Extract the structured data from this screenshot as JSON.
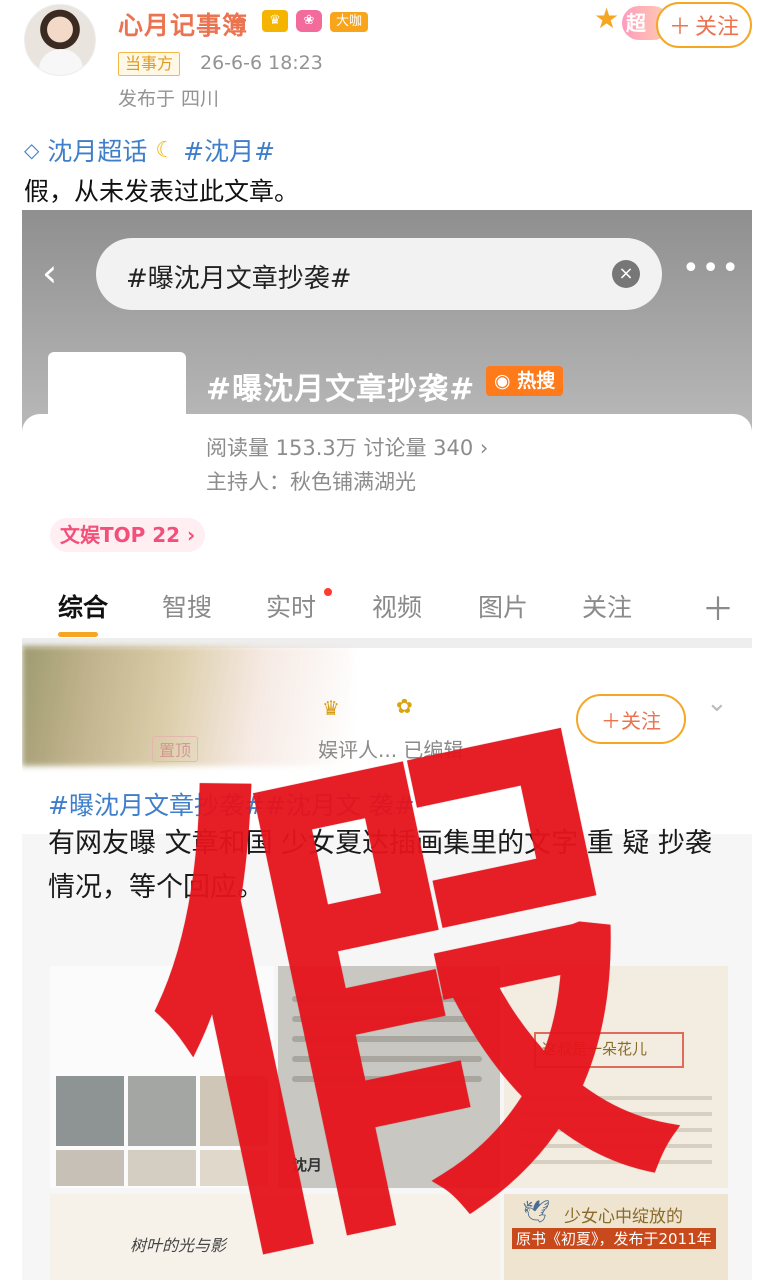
{
  "post": {
    "author": "心月记事簿",
    "badge_big": "大咖",
    "super_label": "超",
    "follow_label": "关注",
    "party_tag": "当事方",
    "time": "26-6-6 18:23",
    "location": "发布于 四川",
    "topic_super": "沈月超话",
    "topic_tag": "#沈月#",
    "body": "假，从未发表过此文章。"
  },
  "screenshot": {
    "search_text": "#曝沈月文章抄袭#",
    "topic_title": "#曝沈月文章抄袭#",
    "hot_label": "热搜",
    "stats": "阅读量 153.3万  讨论量 340  ›",
    "host": "主持人：秋色铺满湖光",
    "rank": "文娱TOP 22 ›",
    "tabs": [
      "综合",
      "智搜",
      "实时",
      "视频",
      "图片",
      "关注"
    ],
    "inner_meta": "娱评人... 已编辑",
    "inner_top_label": "置顶",
    "inner_follow": "关注",
    "inner_topics": "#曝沈月文章抄袭##沈月文        袭#",
    "inner_text": "有网友曝            文章和国   少女夏达插画集里的文字     重      疑   抄袭      情况，等个回应。",
    "g2_caption": "沈月",
    "g3_box": "这叔是一朵花儿",
    "g4_text": "树叶的光与影",
    "g5_title": "少女心中绽放的",
    "g5_banner": "原书《初夏》，发布于2011年",
    "stamp": "假"
  }
}
